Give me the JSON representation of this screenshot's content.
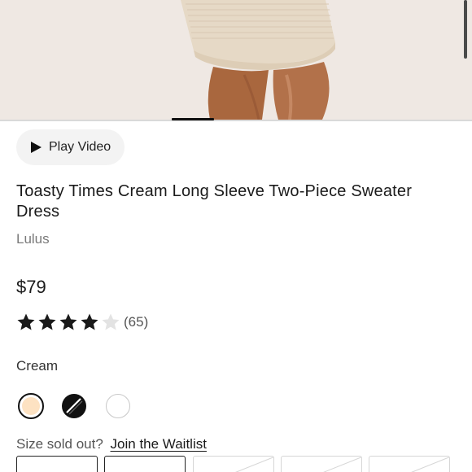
{
  "hero": {
    "image": "model-wearing-cream-sweater-dress",
    "carousel_index": 2
  },
  "video": {
    "label": "Play Video",
    "icon": "play-icon"
  },
  "product": {
    "title": "Toasty Times Cream Long Sleeve Two-Piece Sweater Dress",
    "brand": "Lulus",
    "price": "$79",
    "rating": {
      "value": 4,
      "max": 5,
      "count_text": "(65)"
    },
    "color_label": "Cream"
  },
  "colors": [
    {
      "name": "cream",
      "hex": "#fde2c2",
      "selected": true
    },
    {
      "name": "black",
      "hex": "#111111",
      "selected": false
    },
    {
      "name": "white",
      "hex": "#ffffff",
      "selected": false
    }
  ],
  "sizes": {
    "sold_out_text": "Size sold out?",
    "waitlist_link": "Join the Waitlist",
    "boxes": [
      {
        "available": true
      },
      {
        "available": true
      },
      {
        "available": false
      },
      {
        "available": false
      },
      {
        "available": false
      }
    ]
  },
  "theme": {
    "accent": "#111111",
    "muted_text": "#7a7a7a",
    "pill_bg": "#f3f3f3"
  }
}
